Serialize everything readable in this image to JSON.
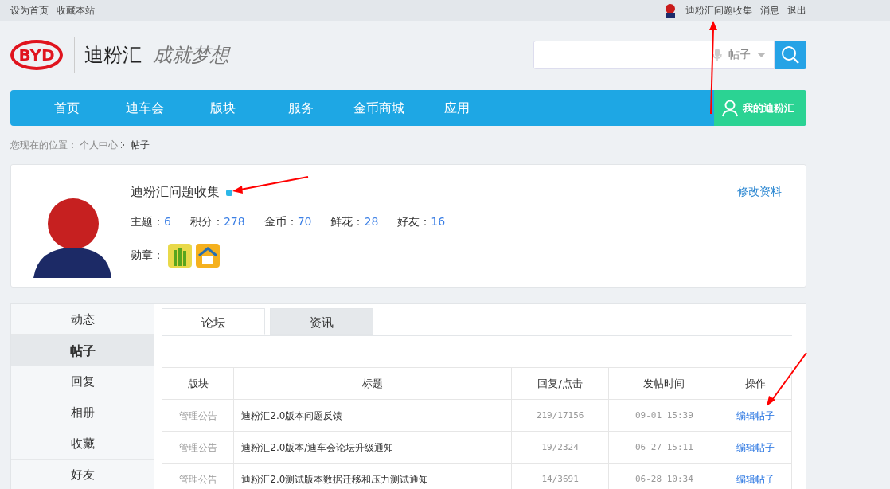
{
  "top_bar": {
    "links": [
      "设为首页",
      "收藏本站"
    ],
    "user_name": "迪粉汇问题收集",
    "actions": [
      "消息",
      "退出"
    ]
  },
  "header": {
    "logo_text": "BYD",
    "site_name": "迪粉汇",
    "slogan": "成就梦想",
    "search": {
      "scope": "帖子"
    }
  },
  "nav": {
    "items": [
      "首页",
      "迪车会",
      "版块",
      "服务",
      "金币商城",
      "应用"
    ],
    "my_button": "我的迪粉汇"
  },
  "breadcrumb": {
    "label": "您现在的位置：",
    "parent": "个人中心",
    "current": "帖子"
  },
  "profile": {
    "name": "迪粉汇问题收集",
    "edit_link": "修改资料",
    "medals_label": "勋章：",
    "stats": [
      {
        "label": "主题：",
        "value": "6"
      },
      {
        "label": "积分：",
        "value": "278"
      },
      {
        "label": "金币：",
        "value": "70"
      },
      {
        "label": "鲜花：",
        "value": "28"
      },
      {
        "label": "好友：",
        "value": "16"
      }
    ]
  },
  "sidebar": {
    "items": [
      {
        "label": "动态",
        "selected": false
      },
      {
        "label": "帖子",
        "selected": true
      },
      {
        "label": "回复",
        "selected": false
      },
      {
        "label": "相册",
        "selected": false
      },
      {
        "label": "收藏",
        "selected": false
      },
      {
        "label": "好友",
        "selected": false
      }
    ]
  },
  "tabs": [
    {
      "label": "论坛",
      "selected": true
    },
    {
      "label": "资讯",
      "selected": false
    }
  ],
  "table": {
    "columns": [
      "版块",
      "标题",
      "回复/点击",
      "发帖时间",
      "操作"
    ],
    "rows": [
      {
        "board": "管理公告",
        "title": "迪粉汇2.0版本问题反馈",
        "stats": "219/17156",
        "time": "09-01 15:39",
        "action": "编辑帖子"
      },
      {
        "board": "管理公告",
        "title": "迪粉汇2.0版本/迪车会论坛升级通知",
        "stats": "19/2324",
        "time": "06-27 15:11",
        "action": "编辑帖子"
      },
      {
        "board": "管理公告",
        "title": "迪粉汇2.0测试版本数据迁移和压力测试通知",
        "stats": "14/3691",
        "time": "06-28 10:34",
        "action": "编辑帖子"
      }
    ]
  }
}
